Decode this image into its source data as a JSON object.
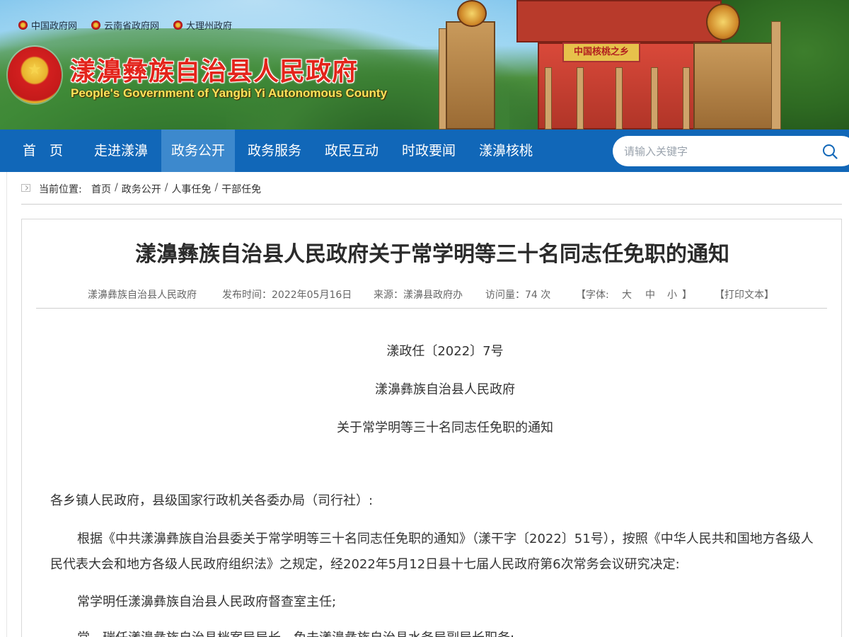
{
  "top_links": [
    "中国政府网",
    "云南省政府网",
    "大理州政府"
  ],
  "site": {
    "title": "漾濞彝族自治县人民政府",
    "subtitle": "People's Government of Yangbi Yi Autonomous County",
    "plaque": "中国核桃之乡"
  },
  "nav": {
    "items": [
      "首　页",
      "走进漾濞",
      "政务公开",
      "政务服务",
      "政民互动",
      "时政要闻",
      "漾濞核桃"
    ],
    "active_index": 2
  },
  "search": {
    "placeholder": "请输入关键字"
  },
  "breadcrumb": {
    "label": "当前位置:",
    "items": [
      "首页",
      "政务公开",
      "人事任免",
      "干部任免"
    ]
  },
  "article": {
    "title": "漾濞彝族自治县人民政府关于常学明等三十名同志任免职的通知",
    "meta": {
      "publisher": "漾濞彝族自治县人民政府",
      "publish_time": "发布时间：2022年05月16日",
      "source": "来源：漾濞县政府办",
      "visits": "访问量：74 次",
      "font_label": "【字体:",
      "font_large": "大",
      "font_medium": "中",
      "font_small": "小",
      "font_close": "】",
      "print": "【打印文本】"
    },
    "doc_number": "漾政任〔2022〕7号",
    "doc_org": "漾濞彝族自治县人民政府",
    "doc_subject": "关于常学明等三十名同志任免职的通知",
    "salutation": "各乡镇人民政府，县级国家行政机关各委办局（司行社）:",
    "body1": "根据《中共漾濞彝族自治县委关于常学明等三十名同志任免职的通知》（漾干字〔2022〕51号），按照《中华人民共和国地方各级人民代表大会和地方各级人民政府组织法》之规定，经2022年5月12日县十七届人民政府第6次常务会议研究决定:",
    "body2": "常学明任漾濞彝族自治县人民政府督查室主任;",
    "body3": "常　瑞任漾濞彝族自治县档案局局长，免去漾濞彝族自治县水务局副局长职务;"
  }
}
